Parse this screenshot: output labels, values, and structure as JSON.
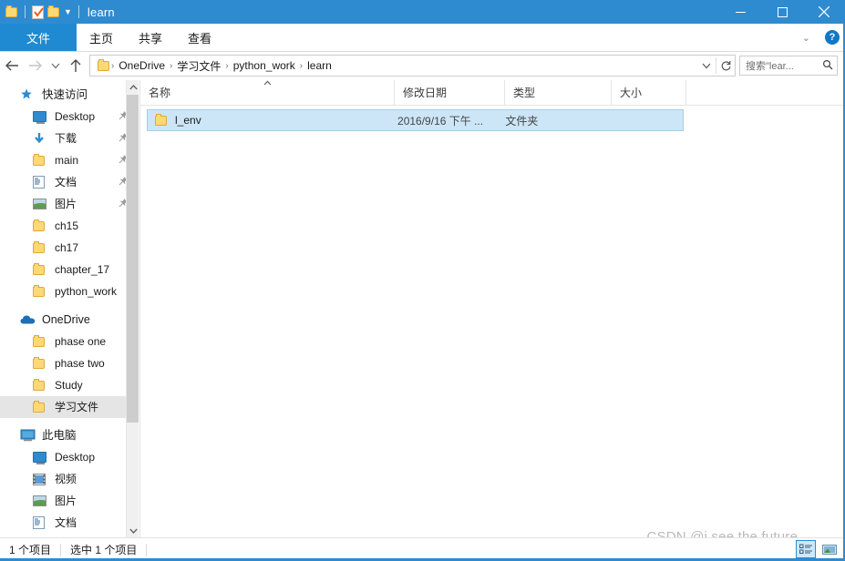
{
  "window": {
    "title": "learn",
    "quick_access_toolbar": [
      {
        "icon": "folder-icon",
        "name": "folder-properties"
      },
      {
        "icon": "properties-icon",
        "name": "properties"
      },
      {
        "icon": "new-folder-icon",
        "name": "new-folder"
      },
      {
        "icon": "chevron-down-icon",
        "name": "customize-qat"
      }
    ],
    "caption_buttons": [
      {
        "name": "minimize-button",
        "glyph": "minimize-icon"
      },
      {
        "name": "maximize-button",
        "glyph": "maximize-icon"
      },
      {
        "name": "close-button",
        "glyph": "close-icon"
      }
    ]
  },
  "ribbon": {
    "tabs": [
      {
        "label": "文件",
        "active": true
      },
      {
        "label": "主页",
        "active": false
      },
      {
        "label": "共享",
        "active": false
      },
      {
        "label": "查看",
        "active": false
      }
    ],
    "expand_icon": "chevron-down-icon",
    "help_label": "?"
  },
  "navigation": {
    "back_icon": "arrow-left-icon",
    "forward_icon": "arrow-right-icon",
    "recent_icon": "chevron-down-icon",
    "up_icon": "arrow-up-icon",
    "breadcrumbs": [
      "OneDrive",
      "学习文件",
      "python_work",
      "learn"
    ],
    "breadcrumb_separator": "›",
    "dropdown_icon": "chevron-down-icon",
    "refresh_icon": "refresh-icon"
  },
  "search": {
    "placeholder": "搜索\"lear...",
    "icon": "search-icon"
  },
  "sidebar": {
    "sections": [
      {
        "name": "quick-access",
        "label": "快速访问",
        "icon": "star-pin-icon",
        "items": [
          {
            "label": "Desktop",
            "icon": "monitor-icon",
            "pinned": true
          },
          {
            "label": "下载",
            "icon": "download-icon",
            "pinned": true
          },
          {
            "label": "main",
            "icon": "folder-icon",
            "pinned": true
          },
          {
            "label": "文档",
            "icon": "document-icon",
            "pinned": true
          },
          {
            "label": "图片",
            "icon": "picture-icon",
            "pinned": true
          },
          {
            "label": "ch15",
            "icon": "folder-icon",
            "pinned": false
          },
          {
            "label": "ch17",
            "icon": "folder-icon",
            "pinned": false
          },
          {
            "label": "chapter_17",
            "icon": "folder-icon",
            "pinned": false
          },
          {
            "label": "python_work",
            "icon": "folder-icon",
            "pinned": false
          }
        ]
      },
      {
        "name": "onedrive",
        "label": "OneDrive",
        "icon": "cloud-icon",
        "items": [
          {
            "label": "phase one",
            "icon": "folder-icon",
            "selected": false
          },
          {
            "label": "phase two",
            "icon": "folder-icon",
            "selected": false
          },
          {
            "label": "Study",
            "icon": "folder-icon",
            "selected": false
          },
          {
            "label": "学习文件",
            "icon": "folder-icon",
            "selected": true
          }
        ]
      },
      {
        "name": "this-pc",
        "label": "此电脑",
        "icon": "computer-icon",
        "items": [
          {
            "label": "Desktop",
            "icon": "monitor-icon"
          },
          {
            "label": "视频",
            "icon": "video-icon"
          },
          {
            "label": "图片",
            "icon": "picture-icon"
          },
          {
            "label": "文档",
            "icon": "document-icon"
          }
        ]
      }
    ],
    "scrollbar": {
      "up_icon": "chevron-up-icon",
      "down_icon": "chevron-down-icon"
    }
  },
  "filelist": {
    "columns": [
      {
        "label": "名称",
        "sorted": "asc",
        "sort_icon": "caret-up-icon"
      },
      {
        "label": "修改日期",
        "sorted": null
      },
      {
        "label": "类型",
        "sorted": null
      },
      {
        "label": "大小",
        "sorted": null
      }
    ],
    "rows": [
      {
        "name": "l_env",
        "icon": "folder-icon",
        "date": "2016/9/16 下午 ...",
        "type": "文件夹",
        "size": "",
        "selected": true
      }
    ]
  },
  "statusbar": {
    "item_count": "1 个项目",
    "selection": "选中 1 个项目",
    "view_buttons": [
      {
        "name": "details-view-button",
        "icon": "details-view-icon",
        "active": true
      },
      {
        "name": "large-icons-view-button",
        "icon": "large-icons-view-icon",
        "active": false
      }
    ]
  },
  "watermark": {
    "text": "CSDN @i see the future"
  },
  "colors": {
    "titlebar": "#2f8bd0",
    "accent": "#1f8ad2",
    "selection": "#cce6f7",
    "selection_border": "#a6cde8",
    "nav_selected": "#e5e5e5",
    "folder": "#fcd975"
  }
}
